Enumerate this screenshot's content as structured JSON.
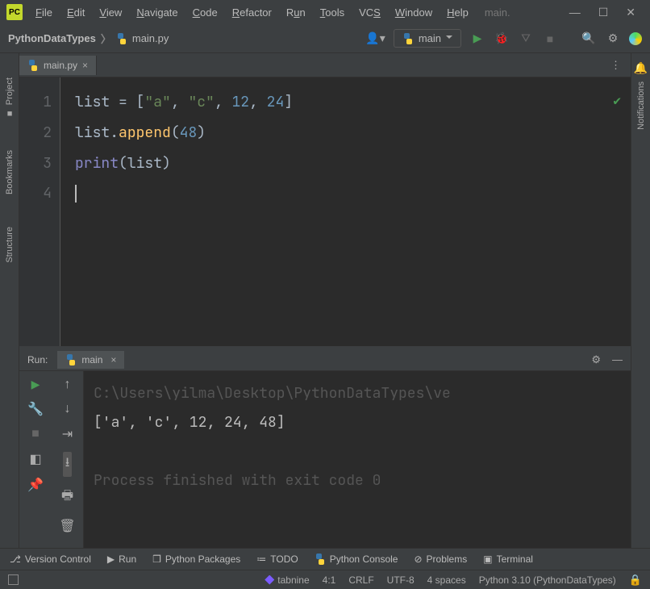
{
  "menu": [
    "File",
    "Edit",
    "View",
    "Navigate",
    "Code",
    "Refactor",
    "Run",
    "Tools",
    "VCS",
    "Window",
    "Help"
  ],
  "title_tail": "main.",
  "breadcrumb": {
    "project": "PythonDataTypes",
    "file": "main.py"
  },
  "run_config": "main",
  "tab": {
    "name": "main.py"
  },
  "left_labels": {
    "project": "Project",
    "bookmarks": "Bookmarks",
    "structure": "Structure"
  },
  "right_labels": {
    "notifications": "Notifications"
  },
  "code": {
    "lines": [
      "1",
      "2",
      "3",
      "4"
    ],
    "l1": {
      "var": "list",
      "eq": " = ",
      "lb": "[",
      "s1": "\"a\"",
      "c1": ", ",
      "s2": "\"c\"",
      "c2": ", ",
      "n1": "12",
      "c3": ", ",
      "n2": "24",
      "rb": "]"
    },
    "l2": {
      "var": "list",
      "dot": ".",
      "method": "append",
      "lp": "(",
      "n": "48",
      "rp": ")"
    },
    "l3": {
      "fn": "print",
      "lp": "(",
      "var": "list",
      "rp": ")"
    }
  },
  "run_panel": {
    "label": "Run:",
    "tab": "main",
    "path": "C:\\Users\\yilma\\Desktop\\PythonDataTypes\\ve",
    "output": "['a', 'c', 12, 24, 48]",
    "exit": "Process finished with exit code 0"
  },
  "bottom": {
    "vcs": "Version Control",
    "run": "Run",
    "packages": "Python Packages",
    "todo": "TODO",
    "console": "Python Console",
    "problems": "Problems",
    "terminal": "Terminal"
  },
  "status": {
    "tabnine": "tabnine",
    "pos": "4:1",
    "le": "CRLF",
    "enc": "UTF-8",
    "indent": "4 spaces",
    "interp": "Python 3.10 (PythonDataTypes)"
  }
}
